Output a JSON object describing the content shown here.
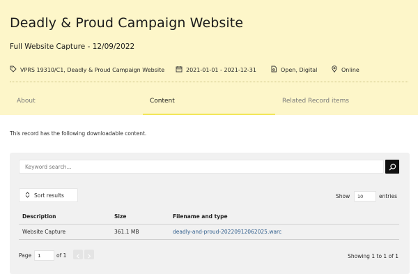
{
  "header": {
    "title": "Deadly & Proud Campaign Website",
    "subtitle": "Full Website Capture - 12/09/2022",
    "meta": [
      {
        "icon": "tag-icon",
        "text": "VPRS 19310/C1, Deadly & Proud Campaign Website"
      },
      {
        "icon": "calendar-icon",
        "text": "2021-01-01 - 2021-12-31"
      },
      {
        "icon": "document-icon",
        "text": "Open, Digital"
      },
      {
        "icon": "location-pin-icon",
        "text": "Online"
      }
    ]
  },
  "tabs": [
    {
      "label": "About",
      "active": false
    },
    {
      "label": "Content",
      "active": true
    },
    {
      "label": "Related Record items",
      "active": false
    }
  ],
  "content": {
    "intro": "This record has the following downloadable content.",
    "search_placeholder": "Keyword search...",
    "sort_label": "Sort results",
    "show_label": "Show",
    "entries_value": "10",
    "entries_label": "entries",
    "table": {
      "headers": [
        "Description",
        "Size",
        "Filename and type"
      ],
      "rows": [
        [
          "Website Capture",
          "361.1 MB",
          "deadly-and-proud-20220912062025.warc"
        ]
      ]
    },
    "pagination": {
      "page_label": "Page",
      "page_value": "1",
      "of_label": "of 1",
      "showing_prefix": "Showing",
      "showing_from": "1",
      "showing_to_word": "to",
      "showing_to": "1",
      "showing_of_word": "of",
      "showing_total": "1"
    }
  },
  "colors": {
    "hero_bg": "#fdf6c9",
    "tab_underline": "#f2e65a",
    "link": "#2f5d8c",
    "panel_bg": "#f1f1f1"
  }
}
